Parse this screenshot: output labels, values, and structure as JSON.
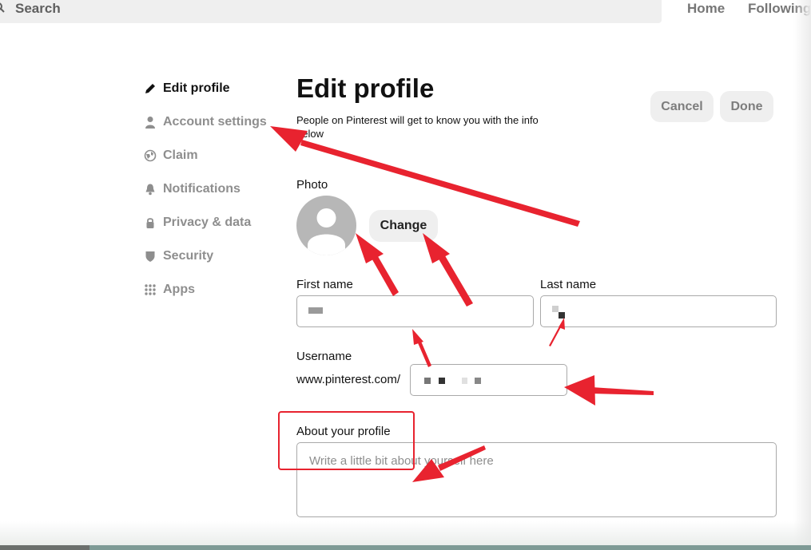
{
  "topbar": {
    "search_label": "Search",
    "nav": [
      "Home",
      "Following"
    ]
  },
  "sidebar": {
    "items": [
      {
        "label": "Edit profile",
        "icon": "pencil-icon",
        "active": true
      },
      {
        "label": "Account settings",
        "icon": "person-icon",
        "active": false
      },
      {
        "label": "Claim",
        "icon": "globe-icon",
        "active": false
      },
      {
        "label": "Notifications",
        "icon": "bell-icon",
        "active": false
      },
      {
        "label": "Privacy & data",
        "icon": "lock-icon",
        "active": false
      },
      {
        "label": "Security",
        "icon": "shield-icon",
        "active": false
      },
      {
        "label": "Apps",
        "icon": "grid-icon",
        "active": false
      }
    ]
  },
  "header": {
    "title": "Edit profile",
    "subtitle": "People on Pinterest will get to know you with the info below",
    "cancel_label": "Cancel",
    "done_label": "Done"
  },
  "form": {
    "photo_label": "Photo",
    "change_label": "Change",
    "first_name_label": "First name",
    "last_name_label": "Last name",
    "username_label": "Username",
    "url_prefix": "www.pinterest.com/",
    "about_label": "About your profile",
    "about_placeholder": "Write a little bit about yourself here"
  },
  "colors": {
    "annotation": "#e8232f",
    "button_bg": "#efefef"
  }
}
